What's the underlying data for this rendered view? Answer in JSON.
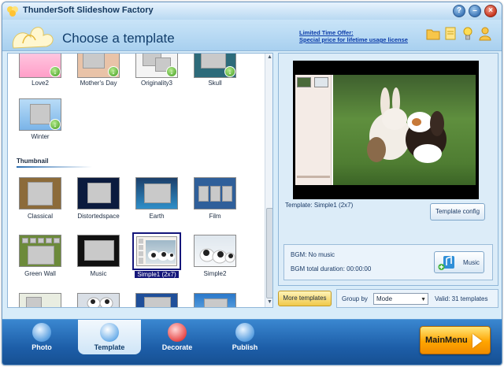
{
  "window": {
    "title": "ThunderSoft Slideshow Factory",
    "buttons": {
      "help": "?",
      "minimize": "–",
      "close": "×"
    }
  },
  "header": {
    "page_title": "Choose a template",
    "offer_line1": "Limited Time Offer:",
    "offer_line2": "Special price for lifetime usage license",
    "icons": [
      "folder-icon",
      "note-icon",
      "lightbulb-icon",
      "user-icon"
    ]
  },
  "templates": {
    "top_row": [
      "Love2",
      "Mother's Day",
      "Originality3",
      "Skull"
    ],
    "second_row": [
      "Winter"
    ],
    "section_title": "Thumbnail",
    "thumbnail_row1": [
      "Classical",
      "Distortedspace",
      "Earth",
      "Film"
    ],
    "thumbnail_row2": [
      "Green Wall",
      "Music",
      "Simple1 (2x7)",
      "Simple2"
    ],
    "selected": "Simple1 (2x7)"
  },
  "preview": {
    "template_label": "Template:  Simple1 (2x7)",
    "template_config_label": "Template config",
    "bgm_text": "BGM: No music",
    "bgm_duration": "BGM total duration: 00:00:00",
    "music_label": "Music"
  },
  "bottom": {
    "more_templates_label": "More templates",
    "group_by_label": "Group by",
    "group_by_value": "Mode",
    "valid_count": "Valid: 31 templates"
  },
  "nav": {
    "items": [
      "Photo",
      "Template",
      "Decorate",
      "Publish"
    ],
    "active": "Template",
    "mainmenu_label": "MainMenu"
  },
  "colors": {
    "accent": "#1d5ea8",
    "selection": "#14167a",
    "mainmenu": "#ffa500"
  }
}
